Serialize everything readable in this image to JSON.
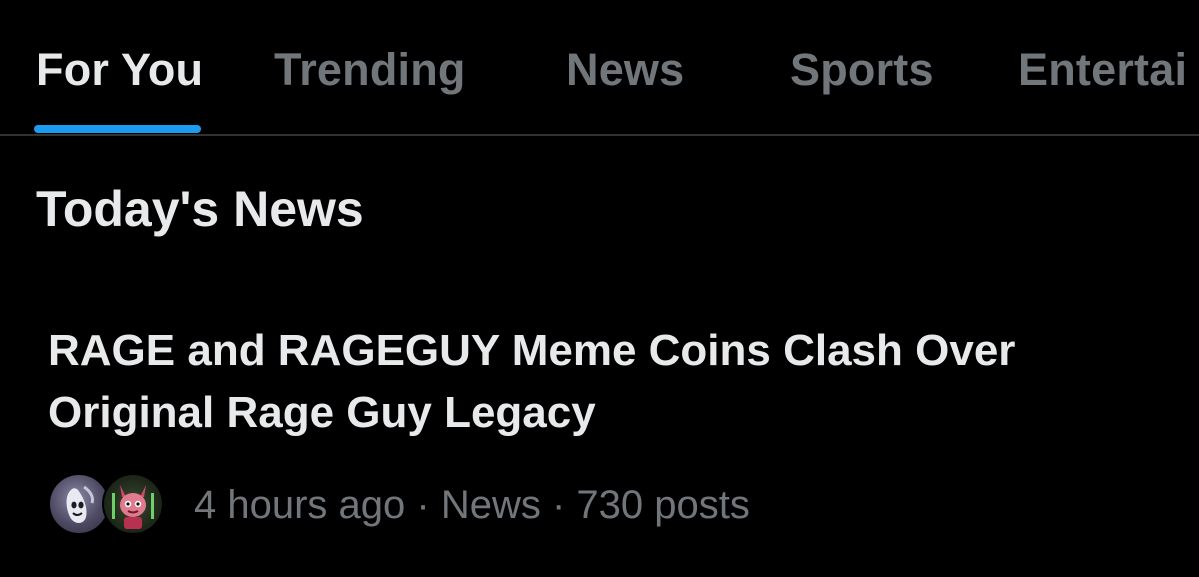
{
  "tabs": [
    {
      "label": "For You",
      "active": true
    },
    {
      "label": "Trending",
      "active": false
    },
    {
      "label": "News",
      "active": false
    },
    {
      "label": "Sports",
      "active": false
    },
    {
      "label": "Entertai",
      "active": false
    }
  ],
  "section": {
    "title": "Today's News"
  },
  "news_item": {
    "headline": "RAGE and RAGEGUY Meme Coins Clash Over Original Rage Guy Legacy",
    "meta": "4 hours ago · News · 730 posts",
    "avatars": [
      "ghost-face-avatar",
      "horned-character-avatar"
    ]
  },
  "colors": {
    "background": "#000000",
    "primary_text": "#e7e9ea",
    "secondary_text": "#71767b",
    "accent": "#1d9bf0",
    "divider": "#2f3336"
  }
}
